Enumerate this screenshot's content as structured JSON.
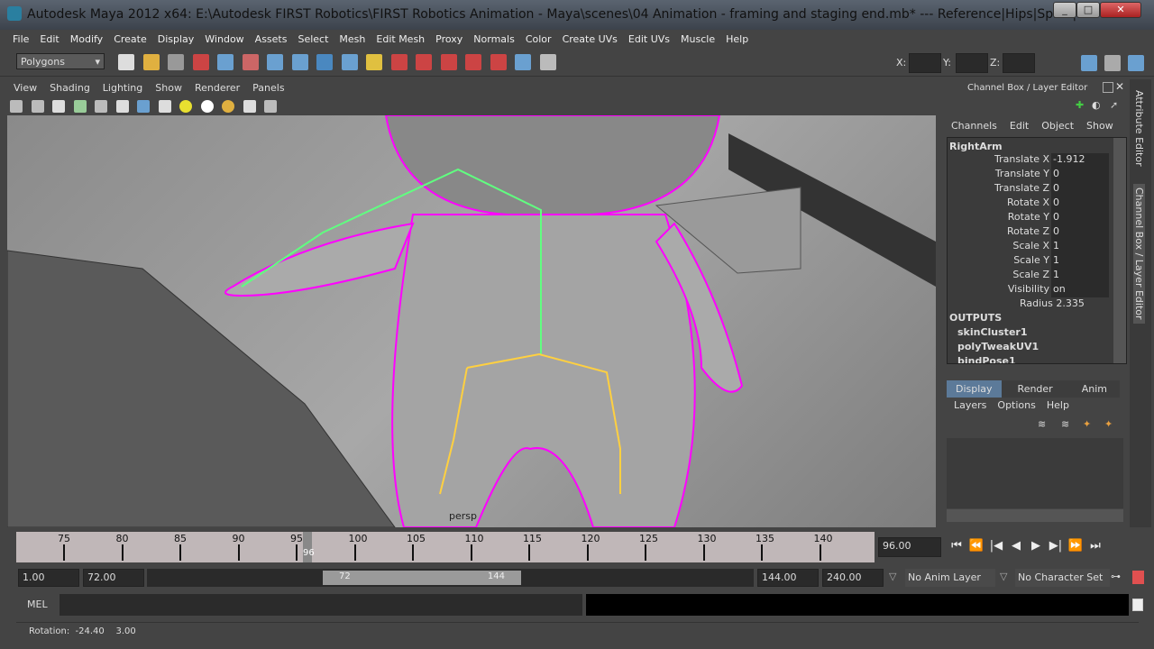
{
  "window": {
    "title": "Autodesk Maya 2012 x64: E:\\Autodesk FIRST Robotics\\FIRST Robotics Animation - Maya\\scenes\\04 Animation - framing and staging end.mb*   ---   Reference|Hips|Spine|..."
  },
  "menubar": [
    "File",
    "Edit",
    "Modify",
    "Create",
    "Display",
    "Window",
    "Assets",
    "Select",
    "Mesh",
    "Edit Mesh",
    "Proxy",
    "Normals",
    "Color",
    "Create UVs",
    "Edit UVs",
    "Muscle",
    "Help"
  ],
  "status": {
    "menuset": "Polygons",
    "x_label": "X:",
    "y_label": "Y:",
    "z_label": "Z:"
  },
  "viewport": {
    "menu": [
      "View",
      "Shading",
      "Lighting",
      "Show",
      "Renderer",
      "Panels"
    ],
    "camera_label": "persp"
  },
  "channelbox": {
    "title": "Channel Box / Layer Editor",
    "menu": [
      "Channels",
      "Edit",
      "Object",
      "Show"
    ],
    "object": "RightArm",
    "channels": [
      {
        "name": "Translate X",
        "value": "-1.912"
      },
      {
        "name": "Translate Y",
        "value": "0"
      },
      {
        "name": "Translate Z",
        "value": "0"
      },
      {
        "name": "Rotate X",
        "value": "0"
      },
      {
        "name": "Rotate Y",
        "value": "0"
      },
      {
        "name": "Rotate Z",
        "value": "0"
      },
      {
        "name": "Scale X",
        "value": "1"
      },
      {
        "name": "Scale Y",
        "value": "1"
      },
      {
        "name": "Scale Z",
        "value": "1"
      },
      {
        "name": "Visibility",
        "value": "on"
      }
    ],
    "radius": "Radius 2.335",
    "outputs_label": "OUTPUTS",
    "outputs": [
      "skinCluster1",
      "polyTweakUV1",
      "bindPose1"
    ]
  },
  "layers": {
    "tabs": [
      "Display",
      "Render",
      "Anim"
    ],
    "active_tab": "Display",
    "menu": [
      "Layers",
      "Options",
      "Help"
    ]
  },
  "side_tabs": [
    "Attribute Editor",
    "Channel Box / Layer Editor"
  ],
  "timeline": {
    "ticks": [
      "75",
      "80",
      "85",
      "90",
      "95",
      "100",
      "105",
      "110",
      "115",
      "120",
      "125",
      "130",
      "135",
      "140"
    ],
    "current": "96",
    "current_field": "96.00"
  },
  "range": {
    "start": "1.00",
    "inner_start": "72.00",
    "slider_start": "72",
    "slider_end": "144",
    "inner_end": "144.00",
    "end": "240.00",
    "anim_layer": "No Anim Layer",
    "character_set": "No Character Set"
  },
  "mel": {
    "label": "MEL"
  },
  "help": {
    "text": "Rotation:  -24.40    3.00"
  }
}
